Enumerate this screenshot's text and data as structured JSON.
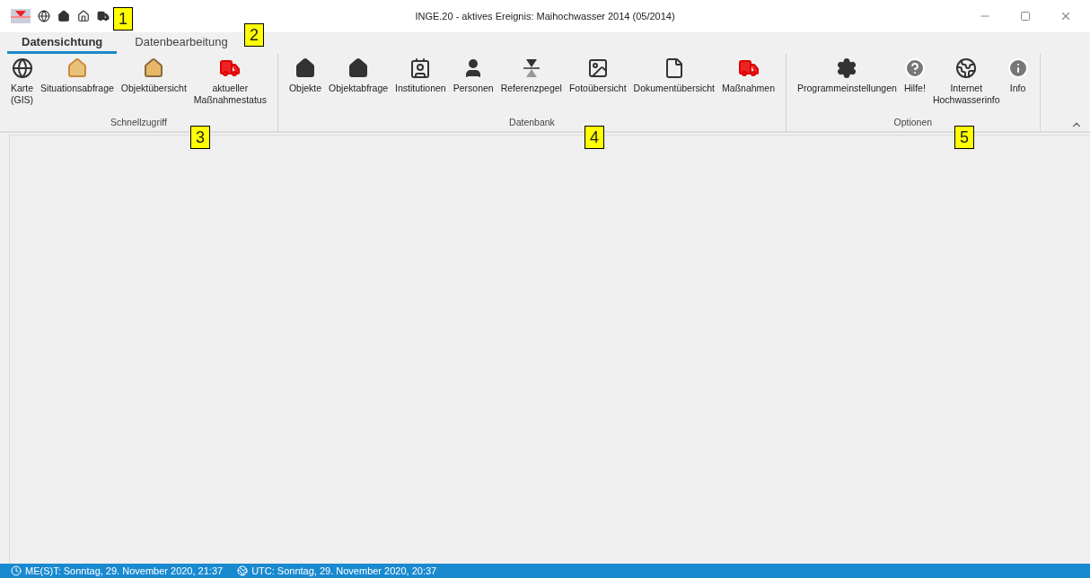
{
  "window": {
    "title": "INGE.20 - aktives Ereignis: Maihochwasser 2014 (05/2014)"
  },
  "tabs": [
    {
      "label": "Datensichtung",
      "selected": true
    },
    {
      "label": "Datenbearbeitung",
      "selected": false
    }
  ],
  "ribbon_groups": [
    {
      "title": "Schnellzugriff",
      "items": [
        "Karte\n(GIS)",
        "Situationsabfrage",
        "Objektübersicht",
        "aktueller\nMaßnahmestatus"
      ]
    },
    {
      "title": "Datenbank",
      "items": [
        "Objekte",
        "Objektabfrage",
        "Institutionen",
        "Personen",
        "Referenzpegel",
        "Fotoübersicht",
        "Dokumentübersicht",
        "Maßnahmen"
      ]
    },
    {
      "title": "Optionen",
      "items": [
        "Programmeinstellungen",
        "Hilfe!",
        "Internet\nHochwasserinfo",
        "Info"
      ]
    }
  ],
  "callouts": [
    "1",
    "2",
    "3",
    "4",
    "5"
  ],
  "status_bar": [
    "ME(S)T: Sonntag, 29. November 2020, 21:37",
    "UTC: Sonntag, 29. November 2020, 20:37"
  ]
}
